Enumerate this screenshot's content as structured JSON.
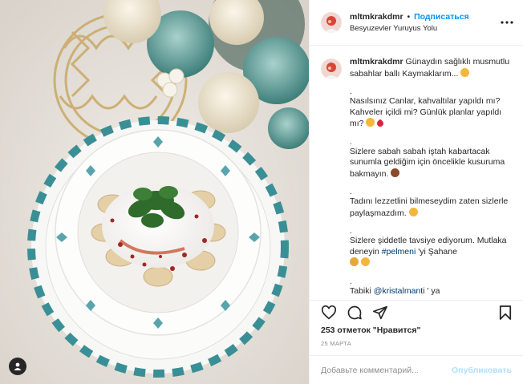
{
  "post": {
    "username": "mltmkrakdmr",
    "follow_label": "Подписаться",
    "location": "Besyuzevler Yuruyus Yolu",
    "caption": {
      "p1": "Günaydın sağlıklı musmutlu sabahlar ballı Kaymaklarım...",
      "p2": "Nasılsınız Canlar, kahvaltılar yapıldı mı? Kahveler içildi mi? Günlük planlar yapıldı mı?",
      "p3": "Sizlere sabah sabah iştah kabartacak sunumla geldiğim için öncelikle kusuruma bakmayın.",
      "p4": "Tadını lezzetlini bilmeseydim zaten sizlerle paylaşmazdım.",
      "p5a": "Sizlere şiddetle tavsiye ediyorum. Mutlaka deneyin",
      "p5_hashtag": "#pelmeni",
      "p5b": "'yi Şahane",
      "p6a": "Tabiki",
      "p6_mention": "@kristalmanti",
      "p6b": "' ya",
      "separator": "."
    },
    "likes_text": "253 отметок \"Нравится\"",
    "date": "25 МАРТА",
    "comment_placeholder": "Добавьте комментарий...",
    "publish_label": "Опубликовать"
  },
  "icons": {
    "more": "more-dots-icon",
    "like": "heart-icon",
    "comment": "comment-bubble-icon",
    "share": "paper-plane-icon",
    "save": "bookmark-icon",
    "tags": "user-tag-icon"
  },
  "colors": {
    "link": "#00376b",
    "follow": "#0095f6",
    "publish_disabled": "#b2dffc",
    "secondary_text": "#8e8e8e"
  }
}
